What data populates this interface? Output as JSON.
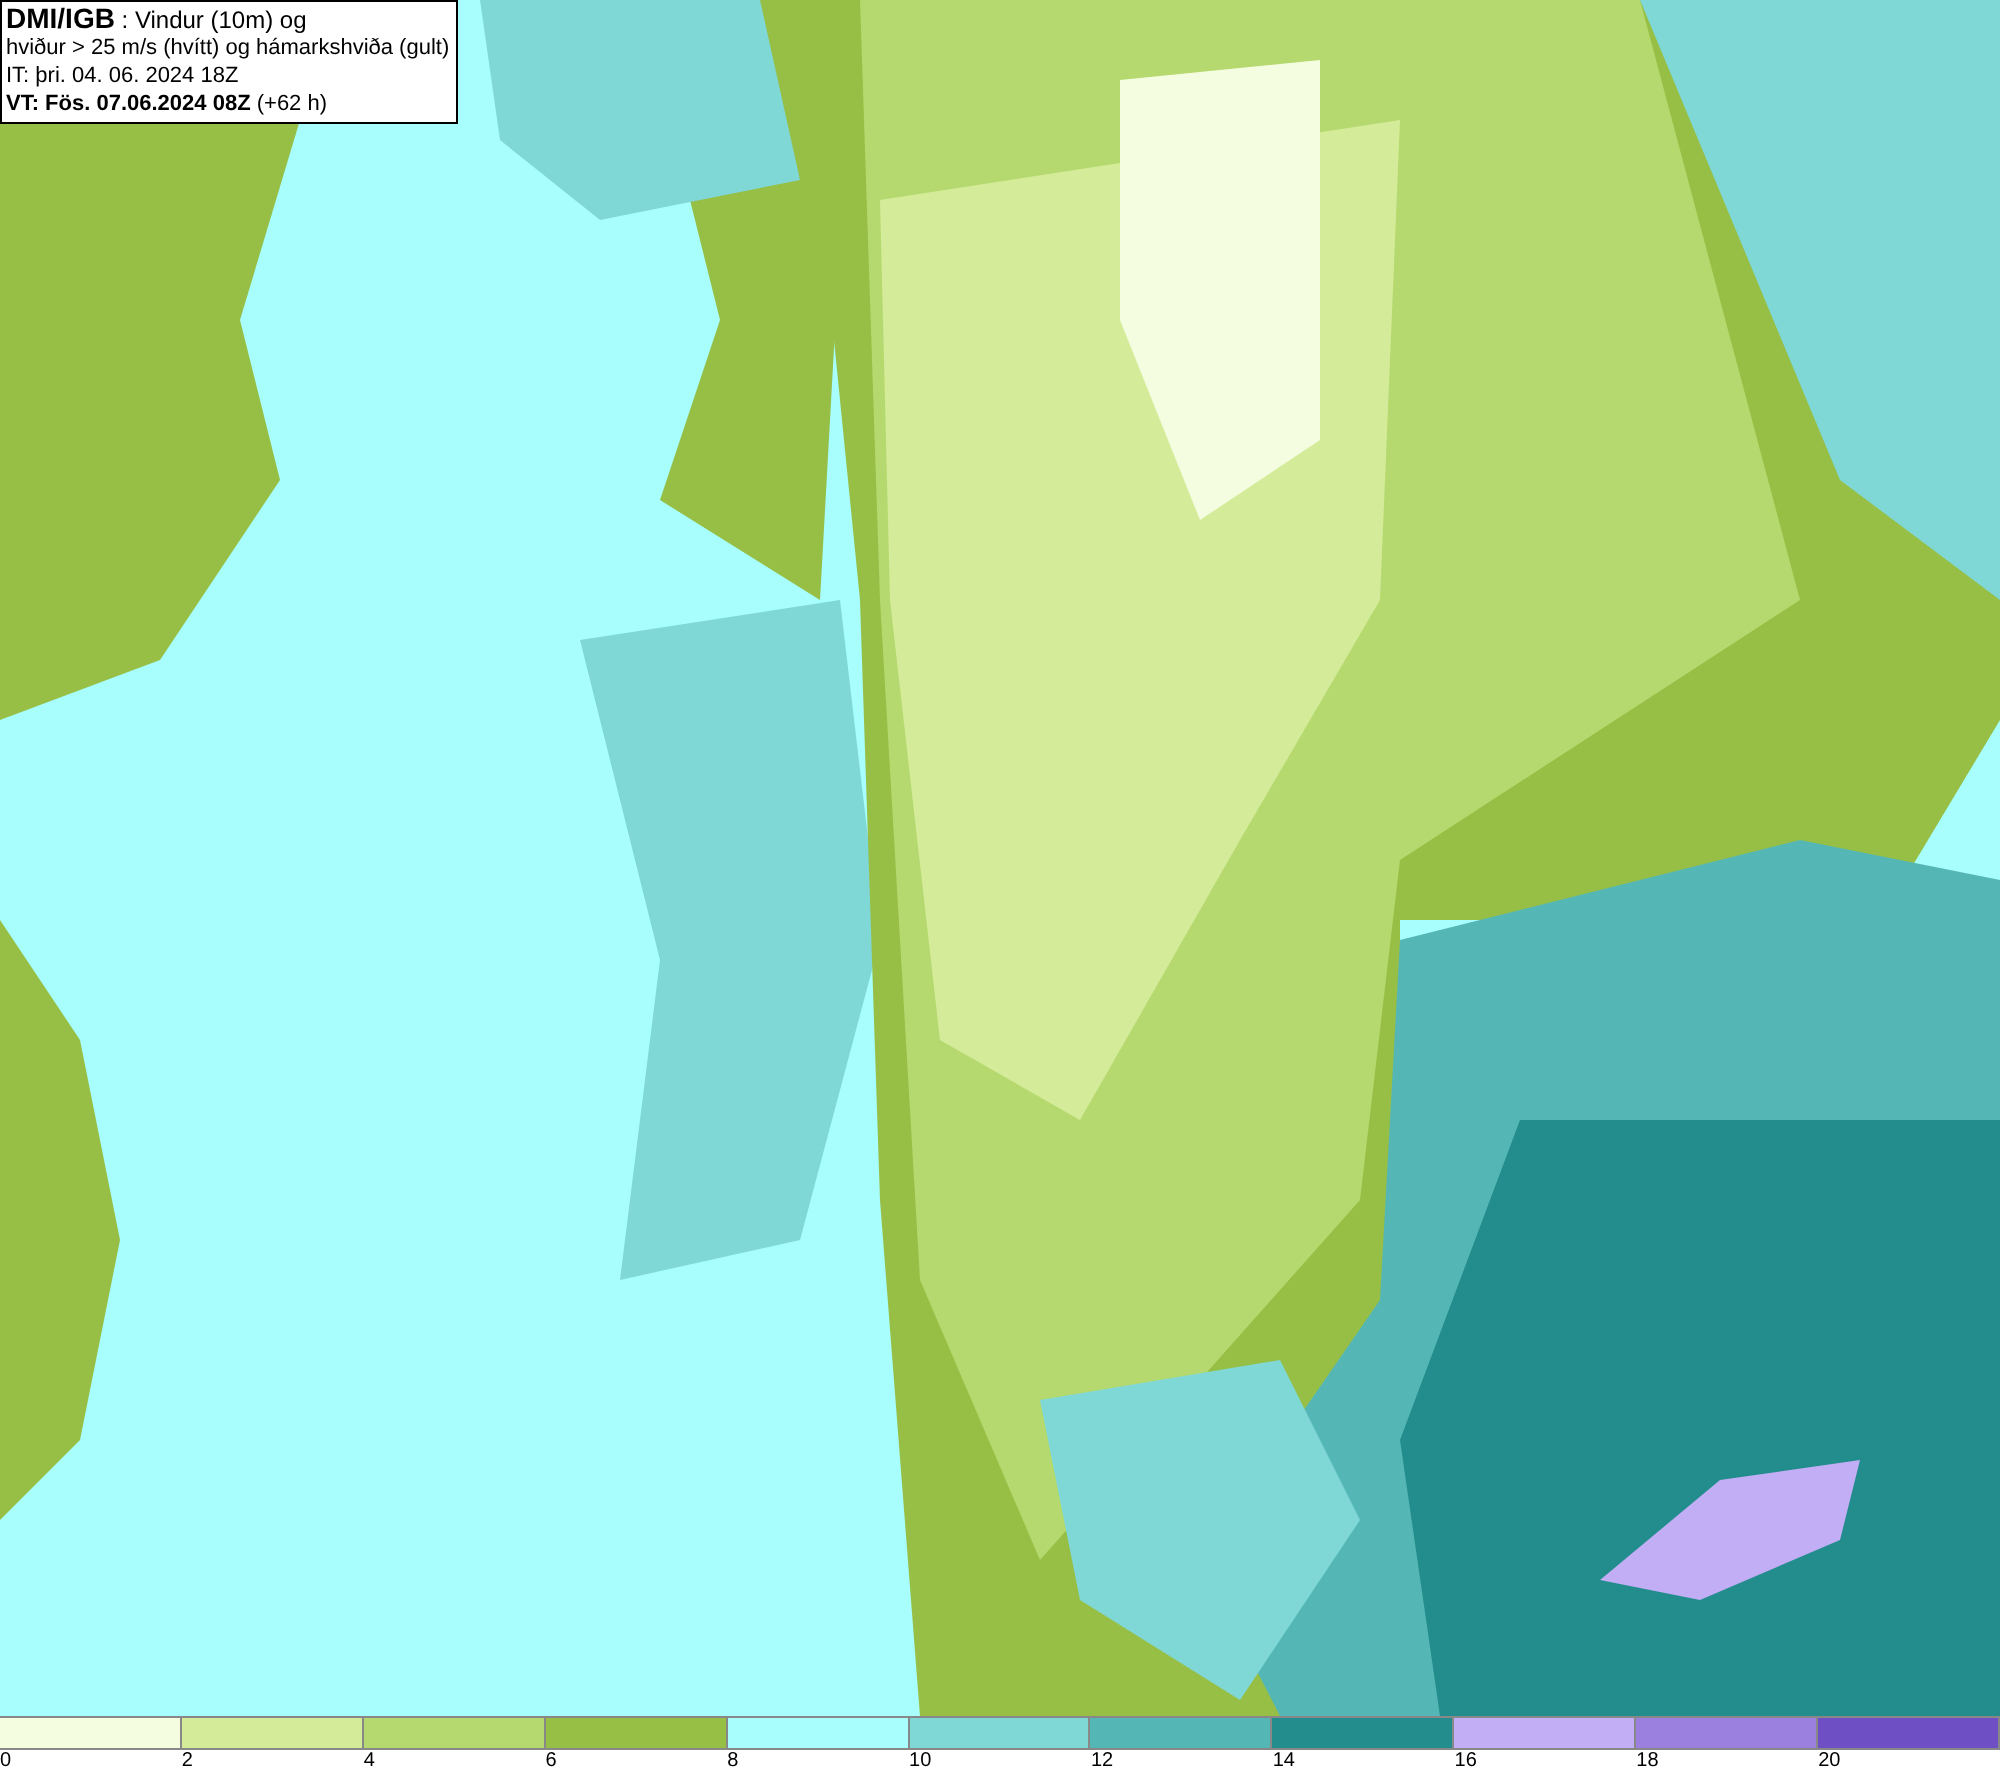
{
  "info_box": {
    "lines": [
      "**DMI/IGB** : Vindur (10m) og",
      "hviður > 25 m/s (hvítt) og hámarkshviða (gult)",
      "IT: þri. 04. 06. 2024 18Z",
      "**VT: Fös. 07.06.2024 08Z** (+62 h)"
    ]
  },
  "legend": {
    "segments": [
      {
        "color": "#f5fde0",
        "label": "0"
      },
      {
        "color": "#d4ec9a",
        "label": "2"
      },
      {
        "color": "#b5d96e",
        "label": "4"
      },
      {
        "color": "#97bf45",
        "label": "6"
      },
      {
        "color": "#a8fdfd",
        "label": "8"
      },
      {
        "color": "#7fd8d6",
        "label": "10"
      },
      {
        "color": "#55b7b5",
        "label": "12"
      },
      {
        "color": "#238c8c",
        "label": "14"
      },
      {
        "color": "#c1aef5",
        "label": "16"
      },
      {
        "color": "#9b80e0",
        "label": "18"
      },
      {
        "color": "#6e4fc4",
        "label": "20"
      }
    ]
  }
}
